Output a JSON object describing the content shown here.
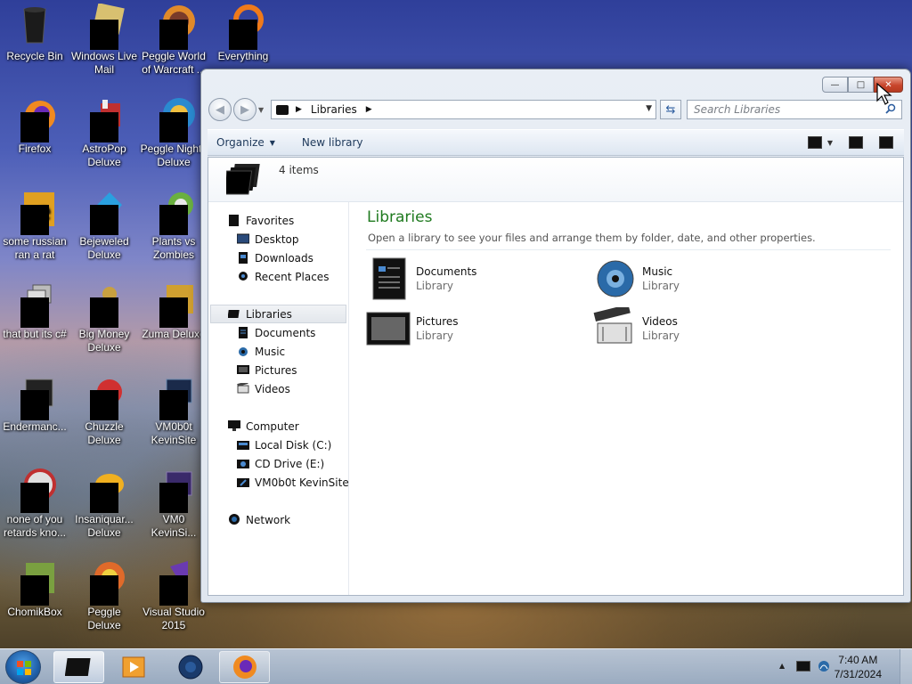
{
  "desktop": {
    "icons": [
      {
        "label": "Recycle Bin",
        "icon": "recycle-bin-icon",
        "redacted": false
      },
      {
        "label": "Windows Live\nMail",
        "icon": "mail-icon",
        "redacted": true
      },
      {
        "label": "Peggle World\nof Warcraft ...",
        "icon": "peggle-wow-icon",
        "redacted": true
      },
      {
        "label": "Everything",
        "icon": "everything-search-icon",
        "redacted": true
      },
      {
        "label": "Firefox",
        "icon": "firefox-icon",
        "redacted": true
      },
      {
        "label": "AstroPop\nDeluxe",
        "icon": "astropop-icon",
        "redacted": true
      },
      {
        "label": "Peggle Nights\nDeluxe",
        "icon": "peggle-nights-icon",
        "redacted": true
      },
      {
        "label": "some russian\nran a rat",
        "icon": "rat-app-icon",
        "redacted": true
      },
      {
        "label": "Bejeweled\nDeluxe",
        "icon": "bejeweled-icon",
        "redacted": true
      },
      {
        "label": "Plants vs\nZombies",
        "icon": "pvz-icon",
        "redacted": true
      },
      {
        "label": "that but its c#",
        "icon": "app-icon",
        "redacted": true
      },
      {
        "label": "Big Money\nDeluxe",
        "icon": "big-money-icon",
        "redacted": true
      },
      {
        "label": "Zuma Deluxe",
        "icon": "zuma-icon",
        "redacted": true
      },
      {
        "label": "Endermanc...",
        "icon": "app-icon",
        "redacted": true
      },
      {
        "label": "Chuzzle\nDeluxe",
        "icon": "chuzzle-icon",
        "redacted": true
      },
      {
        "label": "VM0b0t\nKevinSite",
        "icon": "site-icon",
        "redacted": true
      },
      {
        "label": "none of you\nretards kno...",
        "icon": "app-icon",
        "redacted": true
      },
      {
        "label": "Insaniquar...\nDeluxe",
        "icon": "insaniquarium-icon",
        "redacted": true
      },
      {
        "label": "VM0\nKevinSi...",
        "icon": "site-icon",
        "redacted": true
      },
      {
        "label": "ChomikBox",
        "icon": "chomikbox-icon",
        "redacted": true
      },
      {
        "label": "Peggle Deluxe",
        "icon": "peggle-icon",
        "redacted": true
      },
      {
        "label": "Visual Studio\n2015",
        "icon": "visual-studio-icon",
        "redacted": true
      }
    ]
  },
  "window": {
    "title_buttons": {
      "minimize": "—",
      "maximize": "□",
      "close": "✕"
    },
    "address": {
      "path": "Libraries"
    },
    "search": {
      "placeholder": "Search Libraries"
    },
    "toolbar": {
      "organize": "Organize",
      "new_library": "New library"
    },
    "header": {
      "count": "4 items"
    },
    "nav": {
      "favorites": "Favorites",
      "desktop": "Desktop",
      "downloads": "Downloads",
      "recent": "Recent Places",
      "libraries": "Libraries",
      "documents": "Documents",
      "music": "Music",
      "pictures": "Pictures",
      "videos": "Videos",
      "computer": "Computer",
      "local_disk": "Local Disk (C:)",
      "cd_drive": "CD Drive (E:)",
      "kevinsite": "VM0b0t KevinSite",
      "network": "Network"
    },
    "content": {
      "title": "Libraries",
      "subtitle": "Open a library to see your files and arrange them by folder, date, and other properties.",
      "items": [
        {
          "name": "Documents",
          "type": "Library"
        },
        {
          "name": "Music",
          "type": "Library"
        },
        {
          "name": "Pictures",
          "type": "Library"
        },
        {
          "name": "Videos",
          "type": "Library"
        }
      ]
    }
  },
  "taskbar": {
    "clock_time": "7:40 AM",
    "clock_date": "7/31/2024",
    "tray_arrow": "▲"
  },
  "colors": {
    "content_title": "#1f7a1f",
    "close_button": "#c8452c",
    "toolbar_text": "#1e395b"
  }
}
